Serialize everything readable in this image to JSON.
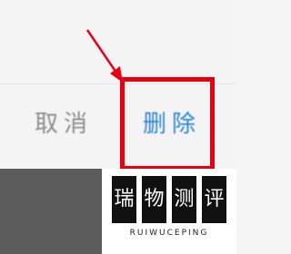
{
  "dialog": {
    "cancel_label": "取消",
    "delete_label": "删除"
  },
  "watermark": {
    "seal_chars": [
      "瑞",
      "物",
      "测",
      "评"
    ],
    "brand": "RUIWUCEPING"
  },
  "colors": {
    "highlight": "#e60012",
    "delete_text": "#2f86d8",
    "cancel_text": "#8e8e8e"
  }
}
